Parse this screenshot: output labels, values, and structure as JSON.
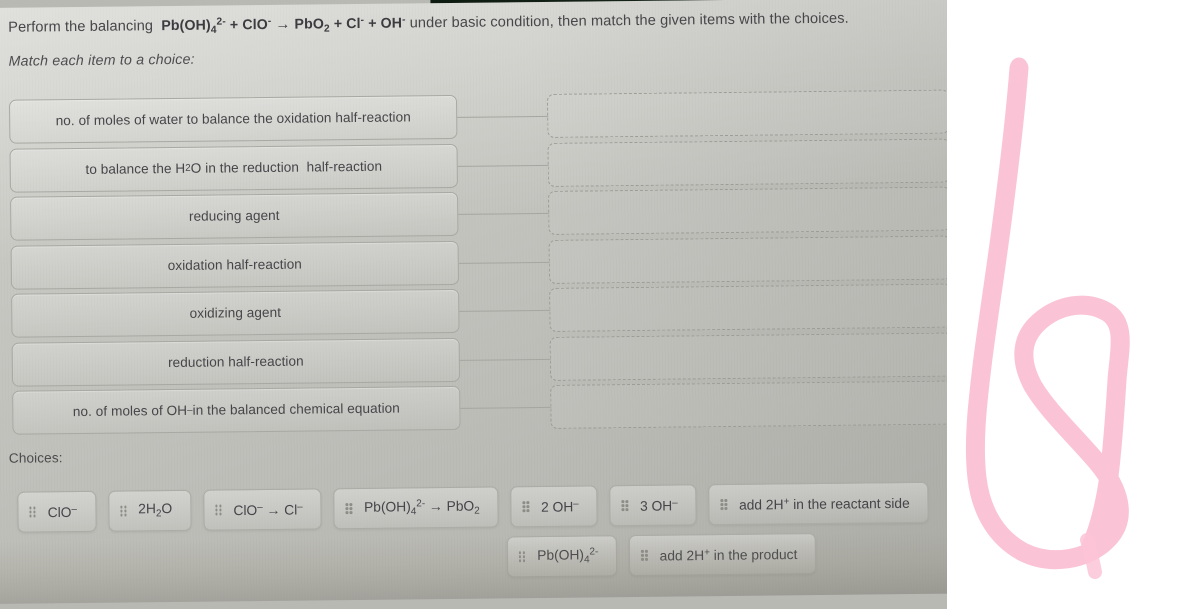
{
  "prompt": {
    "lead": "Perform the balancing",
    "equation": {
      "reactant1": "Pb(OH)",
      "reactant1_sub": "4",
      "reactant1_charge": "2-",
      "plus1": "+",
      "reactant2": "ClO",
      "reactant2_charge": "-",
      "arrow": "→",
      "product1": "PbO",
      "product1_sub": "2",
      "plus2": "+",
      "product2": "Cl",
      "product2_charge": "-",
      "plus3": "+",
      "product3": "OH",
      "product3_charge": "-"
    },
    "tail": "under basic condition, then match the given items with the choices.",
    "instruction": "Match each item to a choice:"
  },
  "rows": [
    {
      "item": "no. of moles of water to balance the oxidation half-reaction",
      "answer": ""
    },
    {
      "item": "to balance the H₂O in the reduction  half-reaction",
      "answer": ""
    },
    {
      "item": "reducing agent",
      "answer": ""
    },
    {
      "item": "oxidation half-reaction",
      "answer": ""
    },
    {
      "item": "oxidizing agent",
      "answer": ""
    },
    {
      "item": "reduction half-reaction",
      "answer": ""
    },
    {
      "item": "no. of moles of OH⁻ in the balanced chemical equation",
      "answer": ""
    }
  ],
  "choices": {
    "label": "Choices:",
    "row1": [
      {
        "text": "ClO⁻",
        "handle": "drag-handle-icon"
      },
      {
        "text": "2H₂O",
        "handle": "drag-handle-icon"
      },
      {
        "text": "ClO⁻ → Cl⁻",
        "handle": "drag-handle-icon"
      },
      {
        "text": "Pb(OH)₄²⁻ → PbO₂",
        "handle": "drag-handle-icon"
      },
      {
        "text": "2 OH⁻",
        "handle": "drag-handle-icon"
      },
      {
        "text": "3 OH⁻",
        "handle": "drag-handle-icon"
      },
      {
        "text": "add 2H⁺ in the reactant side",
        "handle": "drag-handle-icon"
      }
    ],
    "row2": [
      {
        "text": "Pb(OH)₄²⁻",
        "handle": "drag-handle-icon"
      },
      {
        "text": "add 2H⁺ in the product",
        "handle": "drag-handle-icon"
      }
    ]
  },
  "annotation": {
    "name": "pink-marker-stroke",
    "shape": "handwritten-b-loop",
    "color": "#fbc4d6"
  },
  "colors": {
    "page_background": "#bdbdb8",
    "box_border": "#a9a9a4",
    "text": "#46464a",
    "bezel": "#101c12",
    "marker_pink": "#fbc4d6"
  }
}
